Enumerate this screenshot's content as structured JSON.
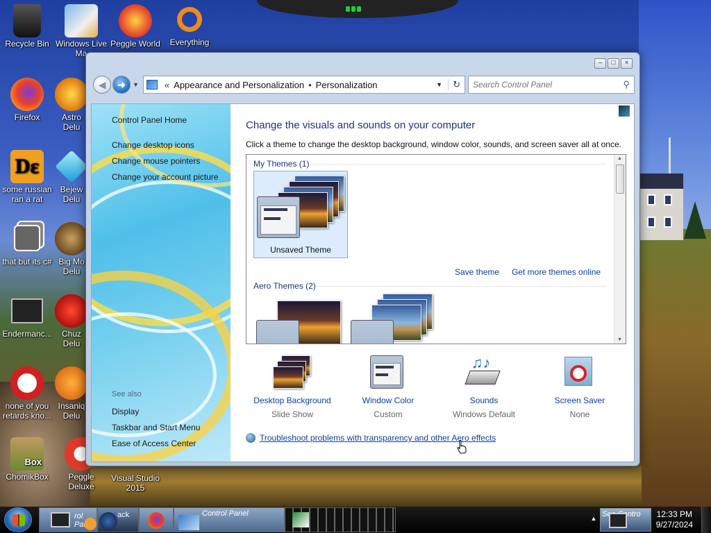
{
  "desktop": {
    "icons": [
      {
        "name": "Recycle Bin",
        "label": "Recycle Bin"
      },
      {
        "name": "Windows Live Mail",
        "label": "Windows Live Ma"
      },
      {
        "name": "Peggle World",
        "label": "Peggle World"
      },
      {
        "name": "Everything",
        "label": "Everything"
      },
      {
        "name": "Firefox",
        "label": "Firefox"
      },
      {
        "name": "Astro",
        "label": "Astro Delu"
      },
      {
        "name": "some russian ran a rat",
        "label": "some russian ran a rat"
      },
      {
        "name": "Bejeweled",
        "label": "Bejew Delu"
      },
      {
        "name": "that but its c#",
        "label": "that but its c#"
      },
      {
        "name": "Big Money",
        "label": "Big Mo Delu"
      },
      {
        "name": "Endermanch",
        "label": "Endermanc..."
      },
      {
        "name": "Chuzzle",
        "label": "Chuz Delu"
      },
      {
        "name": "none of you",
        "label": "none of you retards kno..."
      },
      {
        "name": "Insaniquarium",
        "label": "Insaniq Delu"
      },
      {
        "name": "ChomikBox",
        "label": "ChomikBox"
      },
      {
        "name": "Peggle Deluxe",
        "label": "Peggle Deluxe"
      },
      {
        "name": "Visual Studio 2015",
        "label": "Visual Studio 2015"
      }
    ]
  },
  "window": {
    "breadcrumb": [
      "Appearance and Personalization",
      "Personalization"
    ],
    "breadcrumb_chevron": "«",
    "search_placeholder": "Search Control Panel",
    "left_links": [
      "Control Panel Home",
      "Change desktop icons",
      "Change mouse pointers",
      "Change your account picture"
    ],
    "see_also_label": "See also",
    "see_also_links": [
      "Display",
      "Taskbar and Start Menu",
      "Ease of Access Center"
    ],
    "heading": "Change the visuals and sounds on your computer",
    "subheading": "Click a theme to change the desktop background, window color, sounds, and screen saver all at once.",
    "groups": {
      "my_themes": "My Themes (1)",
      "aero_themes": "Aero Themes (2)"
    },
    "selected_theme": "Unsaved Theme",
    "save_theme": "Save theme",
    "more_themes": "Get more themes online",
    "options": [
      {
        "title": "Desktop Background",
        "sub": "Slide Show"
      },
      {
        "title": "Window Color",
        "sub": "Custom"
      },
      {
        "title": "Sounds",
        "sub": "Windows Default"
      },
      {
        "title": "Screen Saver",
        "sub": "None"
      }
    ],
    "troubleshoot": "Troubleshoot problems with transparency and other Aero effects"
  },
  "taskbar": {
    "items": [
      "rol Panel",
      "ack",
      "Control Panel"
    ],
    "tray_label": "Sea Contro",
    "time": "12:33 PM",
    "date": "9/27/2024"
  },
  "colors": {
    "link": "#0c3ea6",
    "heading": "#1e3287",
    "selection": "#dcecfc"
  }
}
